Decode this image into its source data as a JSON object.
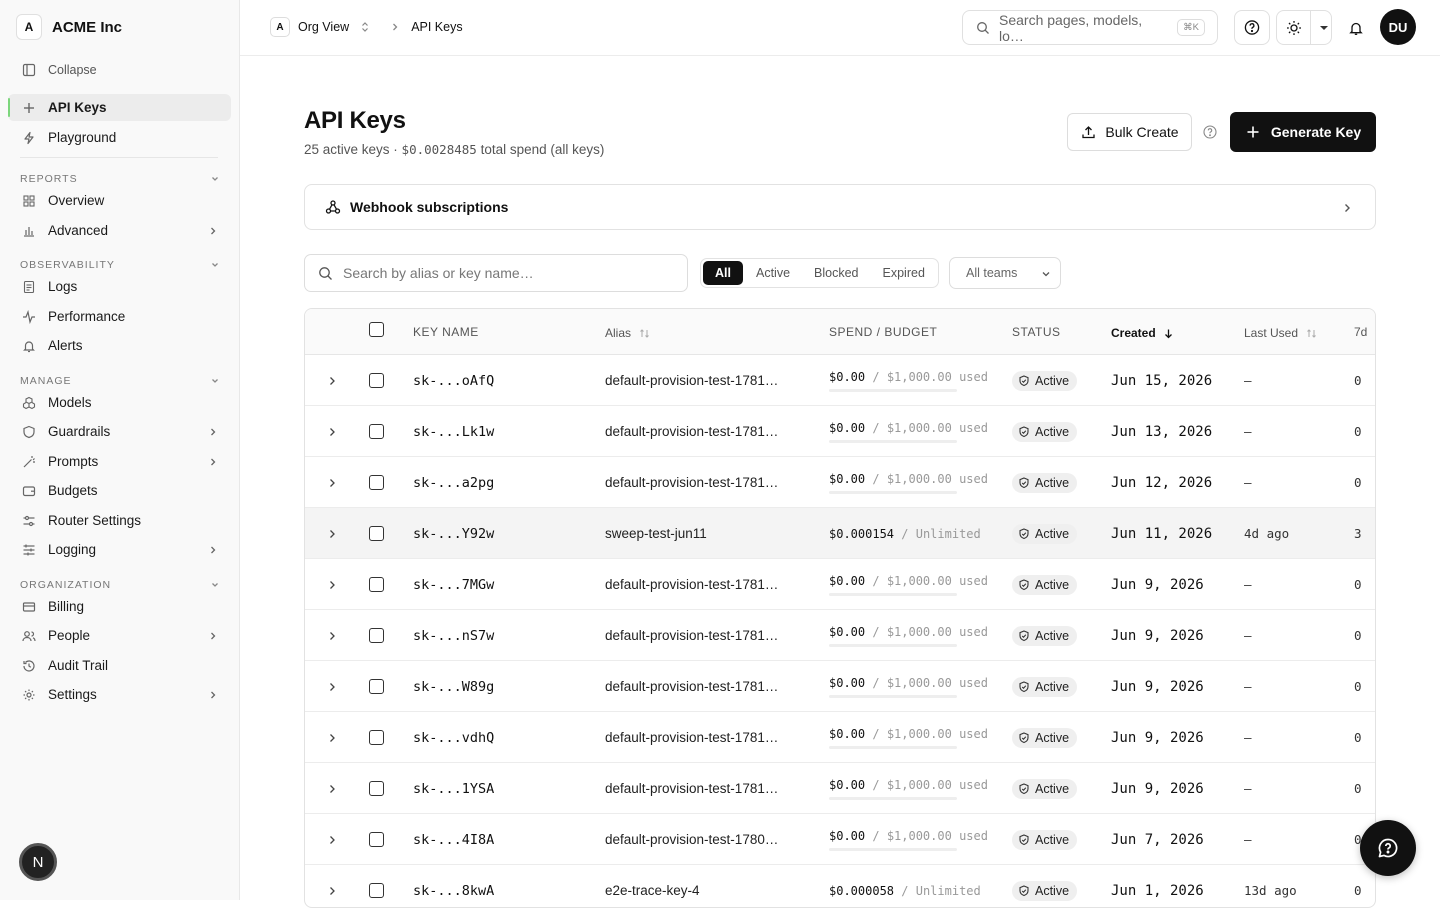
{
  "sidebar": {
    "workspace_initial": "A",
    "workspace_name": "ACME Inc",
    "collapse": "Collapse",
    "top_items": [
      {
        "label": "API Keys",
        "icon": "plus-icon"
      },
      {
        "label": "Playground",
        "icon": "bolt-icon"
      }
    ],
    "sections": [
      {
        "title": "REPORTS",
        "items": [
          {
            "label": "Overview"
          },
          {
            "label": "Advanced"
          }
        ]
      },
      {
        "title": "OBSERVABILITY",
        "items": [
          {
            "label": "Logs"
          },
          {
            "label": "Performance"
          },
          {
            "label": "Alerts"
          }
        ]
      },
      {
        "title": "MANAGE",
        "items": [
          {
            "label": "Models"
          },
          {
            "label": "Guardrails"
          },
          {
            "label": "Prompts"
          },
          {
            "label": "Budgets"
          },
          {
            "label": "Router Settings"
          },
          {
            "label": "Logging"
          }
        ]
      },
      {
        "title": "ORGANIZATION",
        "items": [
          {
            "label": "Billing"
          },
          {
            "label": "People"
          },
          {
            "label": "Audit Trail"
          },
          {
            "label": "Settings"
          }
        ]
      }
    ],
    "bottom_avatar": "N"
  },
  "topbar": {
    "org_initial": "A",
    "org_view": "Org View",
    "page": "API Keys",
    "search_placeholder": "Search pages, models, lo…",
    "search_kbd": "⌘K",
    "user_initials": "DU"
  },
  "main": {
    "title": "API Keys",
    "subtitle_prefix": "25 active keys · ",
    "subtitle_amount": "$0.0028485",
    "subtitle_suffix": " total spend (all keys)",
    "bulk_create": "Bulk Create",
    "generate_key": "Generate Key",
    "webhook": "Webhook subscriptions",
    "key_search_placeholder": "Search by alias or key name…",
    "filters": [
      "All",
      "Active",
      "Blocked",
      "Expired"
    ],
    "teams_select": "All teams"
  },
  "table": {
    "headers": {
      "key_name": "KEY NAME",
      "alias": "Alias",
      "spend": "SPEND / BUDGET",
      "status": "STATUS",
      "created": "Created",
      "last_used": "Last Used",
      "d7": "7d"
    },
    "rows": [
      {
        "key": "sk-...oAfQ",
        "alias": "default-provision-test-1781…",
        "spend": "$0.00",
        "budget": "$1,000.00",
        "used": "used",
        "status": "Active",
        "created": "Jun 15, 2026",
        "last_used": "–",
        "d7": "0"
      },
      {
        "key": "sk-...Lk1w",
        "alias": "default-provision-test-1781…",
        "spend": "$0.00",
        "budget": "$1,000.00",
        "used": "used",
        "status": "Active",
        "created": "Jun 13, 2026",
        "last_used": "–",
        "d7": "0"
      },
      {
        "key": "sk-...a2pg",
        "alias": "default-provision-test-1781…",
        "spend": "$0.00",
        "budget": "$1,000.00",
        "used": "used",
        "status": "Active",
        "created": "Jun 12, 2026",
        "last_used": "–",
        "d7": "0"
      },
      {
        "key": "sk-...Y92w",
        "alias": "sweep-test-jun11",
        "spend": "$0.000154",
        "budget": "Unlimited",
        "used": "",
        "status": "Active",
        "created": "Jun 11, 2026",
        "last_used": "4d ago",
        "d7": "3"
      },
      {
        "key": "sk-...7MGw",
        "alias": "default-provision-test-1781…",
        "spend": "$0.00",
        "budget": "$1,000.00",
        "used": "used",
        "status": "Active",
        "created": "Jun 9, 2026",
        "last_used": "–",
        "d7": "0"
      },
      {
        "key": "sk-...nS7w",
        "alias": "default-provision-test-1781…",
        "spend": "$0.00",
        "budget": "$1,000.00",
        "used": "used",
        "status": "Active",
        "created": "Jun 9, 2026",
        "last_used": "–",
        "d7": "0"
      },
      {
        "key": "sk-...W89g",
        "alias": "default-provision-test-1781…",
        "spend": "$0.00",
        "budget": "$1,000.00",
        "used": "used",
        "status": "Active",
        "created": "Jun 9, 2026",
        "last_used": "–",
        "d7": "0"
      },
      {
        "key": "sk-...vdhQ",
        "alias": "default-provision-test-1781…",
        "spend": "$0.00",
        "budget": "$1,000.00",
        "used": "used",
        "status": "Active",
        "created": "Jun 9, 2026",
        "last_used": "–",
        "d7": "0"
      },
      {
        "key": "sk-...1YSA",
        "alias": "default-provision-test-1781…",
        "spend": "$0.00",
        "budget": "$1,000.00",
        "used": "used",
        "status": "Active",
        "created": "Jun 9, 2026",
        "last_used": "–",
        "d7": "0"
      },
      {
        "key": "sk-...4I8A",
        "alias": "default-provision-test-1780…",
        "spend": "$0.00",
        "budget": "$1,000.00",
        "used": "used",
        "status": "Active",
        "created": "Jun 7, 2026",
        "last_used": "–",
        "d7": "0"
      },
      {
        "key": "sk-...8kwA",
        "alias": "e2e-trace-key-4",
        "spend": "$0.000058",
        "budget": "Unlimited",
        "used": "",
        "status": "Active",
        "created": "Jun 1, 2026",
        "last_used": "13d ago",
        "d7": "0"
      }
    ]
  }
}
